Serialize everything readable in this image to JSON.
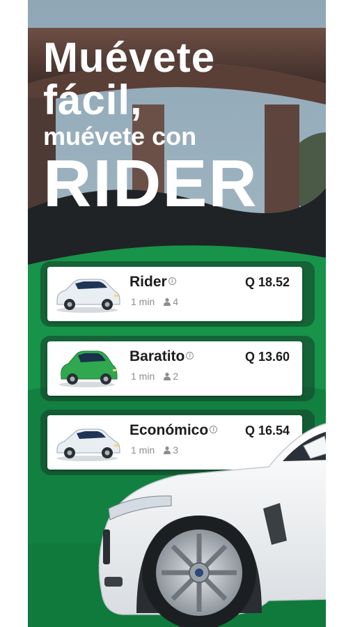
{
  "headline": {
    "line1": "Muévete",
    "line2": "fácil,",
    "line3": "muévete con",
    "line4": "RIDER"
  },
  "rides": [
    {
      "name": "Rider",
      "price": "Q 18.52",
      "eta": "1 min",
      "seats": "4",
      "car_color": "#e9eef3",
      "car_icon": "white-suv-icon"
    },
    {
      "name": "Baratito",
      "price": "Q 13.60",
      "eta": "1 min",
      "seats": "2",
      "car_color": "#2fa84f",
      "car_icon": "green-compact-car-icon"
    },
    {
      "name": "Económico",
      "price": "Q 16.54",
      "eta": "1 min",
      "seats": "3",
      "car_color": "#e9eef3",
      "car_icon": "white-sedan-icon"
    }
  ],
  "colors": {
    "brand_green": "#17934a",
    "dark_green": "#0e6a36",
    "text": "#1c1c1c",
    "muted": "#8d8d8d"
  }
}
